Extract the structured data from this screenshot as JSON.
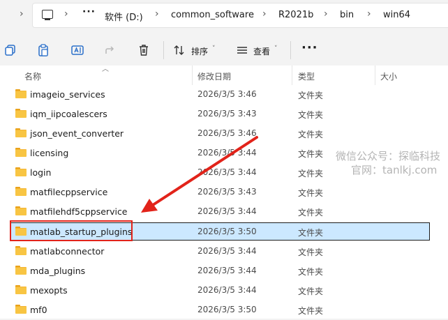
{
  "address_bar": {
    "ellipsis": "···",
    "crumbs": [
      "软件 (D:)",
      "common_software",
      "R2021b",
      "bin",
      "win64"
    ],
    "separator": "›"
  },
  "toolbar": {
    "sort_label": "排序",
    "view_label": "查看",
    "more_label": "···",
    "caret": "˅"
  },
  "columns": {
    "name": "名称",
    "modified": "修改日期",
    "type": "类型",
    "size": "大小"
  },
  "files": [
    {
      "name": "imageio_services",
      "modified": "2026/3/5 3:46",
      "type": "文件夹",
      "size": ""
    },
    {
      "name": "iqm_iipcoalescers",
      "modified": "2026/3/5 3:43",
      "type": "文件夹",
      "size": ""
    },
    {
      "name": "json_event_converter",
      "modified": "2026/3/5 3:46",
      "type": "文件夹",
      "size": ""
    },
    {
      "name": "licensing",
      "modified": "2026/3/5 3:44",
      "type": "文件夹",
      "size": ""
    },
    {
      "name": "login",
      "modified": "2026/3/5 3:44",
      "type": "文件夹",
      "size": ""
    },
    {
      "name": "matfilecppservice",
      "modified": "2026/3/5 3:43",
      "type": "文件夹",
      "size": ""
    },
    {
      "name": "matfilehdf5cppservice",
      "modified": "2026/3/5 3:44",
      "type": "文件夹",
      "size": ""
    },
    {
      "name": "matlab_startup_plugins",
      "modified": "2026/3/5 3:50",
      "type": "文件夹",
      "size": "",
      "selected": true
    },
    {
      "name": "matlabconnector",
      "modified": "2026/3/5 3:44",
      "type": "文件夹",
      "size": ""
    },
    {
      "name": "mda_plugins",
      "modified": "2026/3/5 3:44",
      "type": "文件夹",
      "size": ""
    },
    {
      "name": "mexopts",
      "modified": "2026/3/5 3:44",
      "type": "文件夹",
      "size": ""
    },
    {
      "name": "mf0",
      "modified": "2026/3/5 3:50",
      "type": "文件夹",
      "size": ""
    }
  ],
  "watermark": {
    "line1": "微信公众号：探临科技",
    "line2": "官网：tanlkj.com"
  },
  "colors": {
    "selection": "#cce8ff",
    "highlight_box": "#e2231a",
    "folder": "#f8c543"
  }
}
